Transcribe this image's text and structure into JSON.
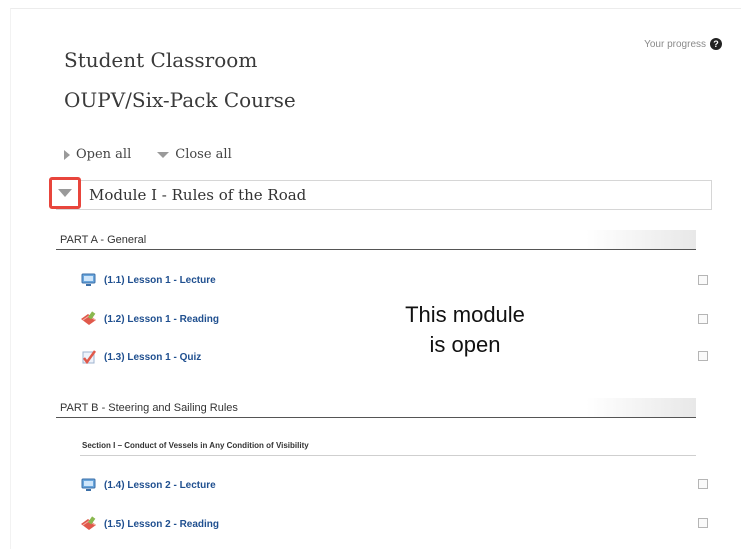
{
  "header": {
    "title": "Student Classroom",
    "course": "OUPV/Six-Pack Course",
    "progress_label": "Your progress",
    "help_glyph": "?"
  },
  "controls": {
    "open_all": "Open all",
    "close_all": "Close all"
  },
  "module": {
    "title": "Module I - Rules of the Road",
    "state": "open"
  },
  "partA": {
    "title": "PART A - General",
    "lessons": [
      {
        "label": "(1.1) Lesson 1 - Lecture",
        "icon": "lecture-icon",
        "checked": false
      },
      {
        "label": "(1.2) Lesson 1 - Reading",
        "icon": "reading-icon",
        "checked": false
      },
      {
        "label": "(1.3) Lesson 1 - Quiz",
        "icon": "quiz-icon",
        "checked": false
      }
    ]
  },
  "partB": {
    "title": "PART B - Steering and Sailing Rules",
    "section": "Section I – Conduct of Vessels in Any Condition of Visibility",
    "lessons": [
      {
        "label": "(1.4) Lesson 2 - Lecture",
        "icon": "lecture-icon",
        "checked": false
      },
      {
        "label": "(1.5) Lesson 2 - Reading",
        "icon": "reading-icon",
        "checked": false
      }
    ]
  },
  "annotation": {
    "line1": "This module",
    "line2": "is open"
  },
  "colors": {
    "highlight": "#e8453c",
    "link": "#1f4f8f"
  }
}
